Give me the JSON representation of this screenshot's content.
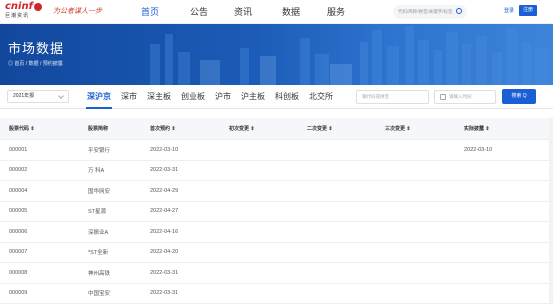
{
  "header": {
    "logo_text": "cninf",
    "logo_sub": "巨潮资讯",
    "slogan": "为公者谋人一步",
    "nav": [
      "首页",
      "公告",
      "资讯",
      "数据",
      "服务"
    ],
    "active_nav": "首页",
    "search_placeholder": "代码/简称/拼音/关键字/标签",
    "login": "登录",
    "register": "注册"
  },
  "banner": {
    "title": "市场数据",
    "breadcrumb": "◎ 首页 / 数据 / 预约披露"
  },
  "filter": {
    "year": "2021年报",
    "markets": [
      "深沪京",
      "深市",
      "深主板",
      "创业板",
      "沪市",
      "沪主板",
      "科创板",
      "北交所"
    ],
    "active_market": "深沪京",
    "code_placeholder": "输代码或拼音",
    "date_placeholder": "请输入时间",
    "search_button": "搜索 Q"
  },
  "table": {
    "columns": [
      "股票代码 ⇕",
      "股票简称",
      "首次预约 ⇕",
      "初次变更 ⇕",
      "二次变更 ⇕",
      "三次变更 ⇕",
      "实际披露 ⇕"
    ],
    "rows": [
      [
        "000001",
        "平安银行",
        "2022-03-10",
        "",
        "",
        "",
        "2022-03-10"
      ],
      [
        "000002",
        "万 科A",
        "2022-03-31",
        "",
        "",
        "",
        ""
      ],
      [
        "000004",
        "国华网安",
        "2022-04-29",
        "",
        "",
        "",
        ""
      ],
      [
        "000005",
        "ST星源",
        "2022-04-27",
        "",
        "",
        "",
        ""
      ],
      [
        "000006",
        "深振业A",
        "2022-04-16",
        "",
        "",
        "",
        ""
      ],
      [
        "000007",
        "*ST全新",
        "2022-04-20",
        "",
        "",
        "",
        ""
      ],
      [
        "000008",
        "神州高铁",
        "2022-03-31",
        "",
        "",
        "",
        ""
      ],
      [
        "000009",
        "中国宝安",
        "2022-03-31",
        "",
        "",
        "",
        ""
      ]
    ]
  },
  "colors": {
    "accent": "#1a5fd6",
    "brand_red": "#d4242b",
    "banner": "#1b5bb7"
  }
}
